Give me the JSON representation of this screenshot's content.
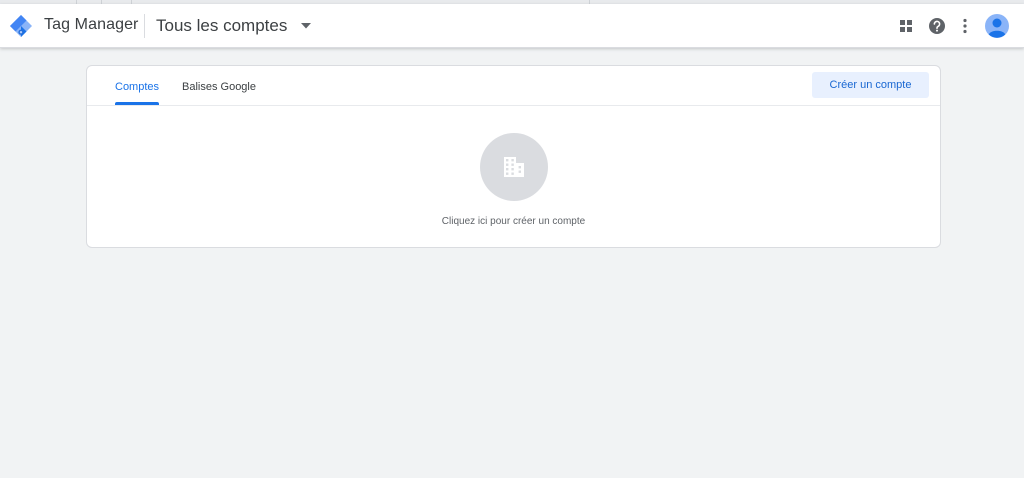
{
  "appbar": {
    "product_name": "Tag Manager",
    "account_selector": "Tous les comptes",
    "icons": [
      "apps-grid-icon",
      "help-icon",
      "more-vert-icon",
      "account-avatar-icon"
    ]
  },
  "card": {
    "tabs": [
      {
        "label": "Comptes",
        "active": true
      },
      {
        "label": "Balises Google",
        "active": false
      }
    ],
    "create_button": "Créer un compte",
    "empty_state": {
      "icon": "building-icon",
      "text": "Cliquez ici pour créer un compte"
    }
  },
  "colors": {
    "accent": "#1a73e8",
    "background": "#f1f3f4",
    "button_bg": "#e8f0fe",
    "empty_circle": "#dadce0"
  }
}
